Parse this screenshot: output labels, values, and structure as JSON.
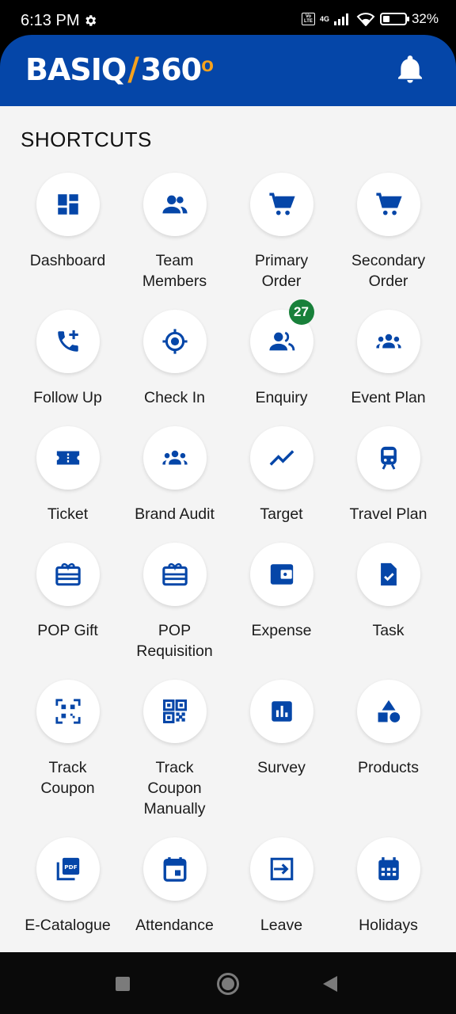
{
  "status_bar": {
    "time": "6:13 PM",
    "battery": "32%",
    "battery_level": 0.32,
    "network": "4G"
  },
  "app": {
    "logo_left": "BASIQ",
    "logo_slash": "/",
    "logo_right": "360",
    "logo_deg": "o"
  },
  "section_title": "SHORTCUTS",
  "colors": {
    "primary": "#0546a8",
    "badge": "#18803a",
    "accent": "#f6a21e"
  },
  "shortcuts": [
    {
      "label": "Dashboard",
      "icon": "dashboard-icon"
    },
    {
      "label": "Team\nMembers",
      "icon": "team-members-icon"
    },
    {
      "label": "Primary\nOrder",
      "icon": "cart-icon"
    },
    {
      "label": "Secondary\nOrder",
      "icon": "cart-icon"
    },
    {
      "label": "Follow Up",
      "icon": "phone-add-icon"
    },
    {
      "label": "Check In",
      "icon": "location-target-icon"
    },
    {
      "label": "Enquiry",
      "icon": "people-icon",
      "badge": "27"
    },
    {
      "label": "Event Plan",
      "icon": "groups-icon"
    },
    {
      "label": "Ticket",
      "icon": "ticket-icon"
    },
    {
      "label": "Brand Audit",
      "icon": "groups-icon"
    },
    {
      "label": "Target",
      "icon": "trending-line-icon"
    },
    {
      "label": "Travel Plan",
      "icon": "train-icon"
    },
    {
      "label": "POP Gift",
      "icon": "gift-card-icon"
    },
    {
      "label": "POP\nRequisition",
      "icon": "gift-card-icon"
    },
    {
      "label": "Expense",
      "icon": "wallet-icon"
    },
    {
      "label": "Task",
      "icon": "task-file-icon"
    },
    {
      "label": "Track\nCoupon",
      "icon": "qr-scan-icon"
    },
    {
      "label": "Track\nCoupon\nManually",
      "icon": "qr-code-icon"
    },
    {
      "label": "Survey",
      "icon": "bar-chart-icon"
    },
    {
      "label": "Products",
      "icon": "shapes-icon"
    },
    {
      "label": "E-Catalogue",
      "icon": "pdf-icon"
    },
    {
      "label": "Attendance",
      "icon": "calendar-event-icon"
    },
    {
      "label": "Leave",
      "icon": "exit-icon"
    },
    {
      "label": "Holidays",
      "icon": "calendar-month-icon"
    }
  ]
}
